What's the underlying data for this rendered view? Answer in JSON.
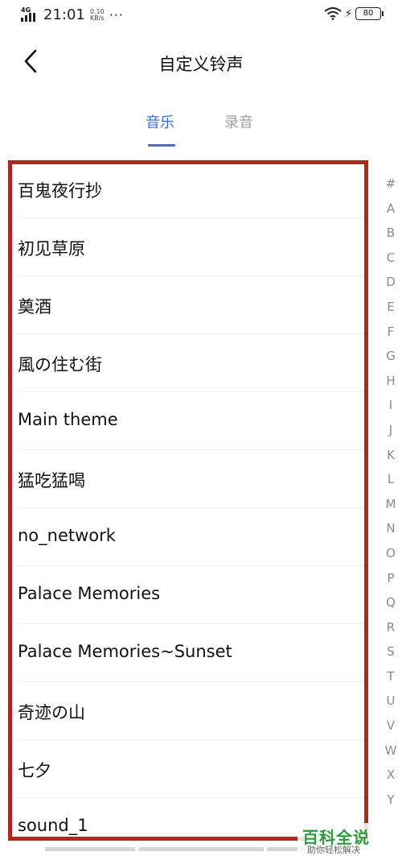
{
  "status_bar": {
    "network": "4G",
    "time": "21:01",
    "speed_value": "0.10",
    "speed_unit": "KB/s",
    "more": "···",
    "battery": "80"
  },
  "header": {
    "back_icon": "chevron-left-icon",
    "title": "自定义铃声"
  },
  "tabs": [
    {
      "label": "音乐",
      "active": true
    },
    {
      "label": "录音",
      "active": false
    }
  ],
  "songs": [
    "百鬼夜行抄",
    "初见草原",
    "奠酒",
    "風の住む街",
    "Main theme",
    "猛吃猛喝",
    "no_network",
    "Palace Memories",
    "Palace Memories~Sunset",
    "奇迹の山",
    "七夕",
    "sound_1"
  ],
  "index_letters": [
    "#",
    "A",
    "B",
    "C",
    "D",
    "E",
    "F",
    "G",
    "H",
    "I",
    "J",
    "K",
    "L",
    "M",
    "N",
    "O",
    "P",
    "Q",
    "R",
    "S",
    "T",
    "U",
    "V",
    "W",
    "X",
    "Y"
  ],
  "watermark": {
    "title": "百科全说",
    "subtitle": "助你轻松解决"
  },
  "colors": {
    "accent": "#3a6fd6",
    "highlight_frame": "#b3261e",
    "watermark": "#2e9b3a"
  }
}
